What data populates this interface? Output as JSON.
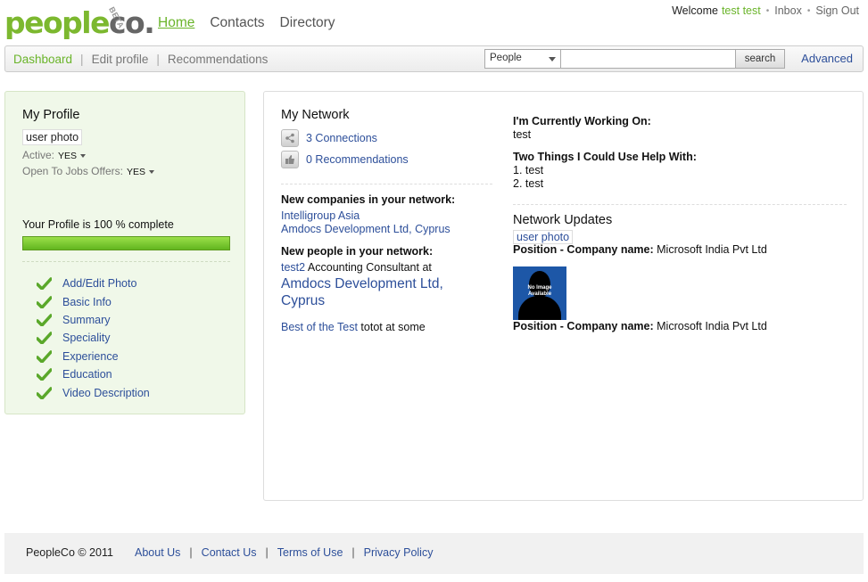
{
  "brand": {
    "name_main": "people",
    "name_co": "co.",
    "beta": "BETA"
  },
  "topnav": [
    {
      "label": "Home",
      "active": true
    },
    {
      "label": "Contacts",
      "active": false
    },
    {
      "label": "Directory",
      "active": false
    }
  ],
  "userbar": {
    "welcome": "Welcome",
    "username": "test test",
    "inbox": "Inbox",
    "signout": "Sign Out"
  },
  "subnav": {
    "dashboard": "Dashboard",
    "edit_profile": "Edit profile",
    "recommendations": "Recommendations"
  },
  "search": {
    "scope": "People",
    "value": "",
    "button": "search",
    "advanced": "Advanced"
  },
  "profile": {
    "title": "My Profile",
    "photo_alt": "user photo",
    "active_label": "Active:",
    "active_value": "YES",
    "jobs_label": "Open To Jobs Offers:",
    "jobs_value": "YES",
    "complete_text": "Your Profile is 100 % complete",
    "complete_pct": 100,
    "checklist": [
      "Add/Edit Photo",
      "Basic Info",
      "Summary",
      "Speciality",
      "Experience",
      "Education",
      "Video Description"
    ]
  },
  "network": {
    "title": "My Network",
    "connections": "3 Connections",
    "recommendations": "0 Recommendations",
    "new_companies_label": "New companies in your network:",
    "companies": [
      "Intelligroup Asia",
      "Amdocs Development Ltd, Cyprus"
    ],
    "new_people_label": "New people in your network:",
    "person_name": "test2",
    "person_role": "Accounting Consultant at",
    "person_company": "Amdocs Development Ltd, Cyprus",
    "best_link": "Best of the Test",
    "best_rest": "totot at some"
  },
  "status": {
    "working_label": "I'm Currently Working On:",
    "working_value": "test",
    "help_label": "Two Things I Could Use Help With:",
    "help_items": [
      "1. test",
      "2. test"
    ]
  },
  "updates": {
    "title": "Network Updates",
    "photo_alt": "user photo",
    "position_label": "Position - Company name:",
    "company": "Microsoft India Pvt Ltd",
    "noimage_text": "No Image Available"
  },
  "footer": {
    "copyright": "PeopleCo © 2011",
    "links": [
      "About Us",
      "Contact Us",
      "Terms of Use",
      "Privacy Policy"
    ]
  },
  "colors": {
    "brand_green": "#7cb82f",
    "link_blue": "#2d4f9a",
    "panel_green": "#f0f8e9"
  }
}
